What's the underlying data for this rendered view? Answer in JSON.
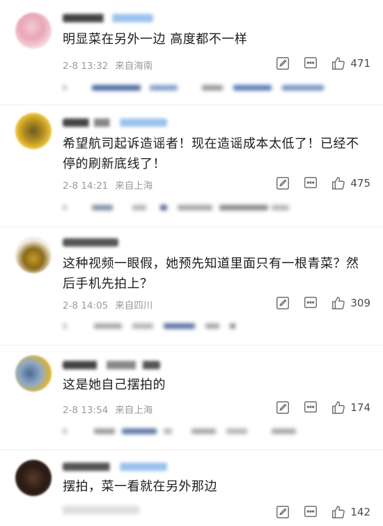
{
  "comments": [
    {
      "text": "明显菜在另外一边 高度都不一样",
      "time": "2-8 13:32",
      "location": "来自海南",
      "likes": "471"
    },
    {
      "text": "希望航司起诉造谣者！现在造谣成本太低了！已经不停的刷新底线了！",
      "time": "2-8 14:21",
      "location": "来自上海",
      "likes": "475"
    },
    {
      "text": "这种视频一眼假，她预先知道里面只有一根青菜？然后手机先拍上？",
      "time": "2-8 14:05",
      "location": "来自四川",
      "likes": "309"
    },
    {
      "text": "这是她自己摆拍的",
      "time": "2-8 13:54",
      "location": "来自上海",
      "likes": "174"
    },
    {
      "text": "摆拍，菜一看就在另外那边",
      "time": "",
      "location": "",
      "likes": "142"
    }
  ],
  "icons": {
    "edit": "edit-icon",
    "comment": "comment-icon",
    "like": "thumbs-up-icon"
  },
  "colors": {
    "accent_blue": "#3d72c9",
    "meta_gray": "#9a9a9a"
  }
}
